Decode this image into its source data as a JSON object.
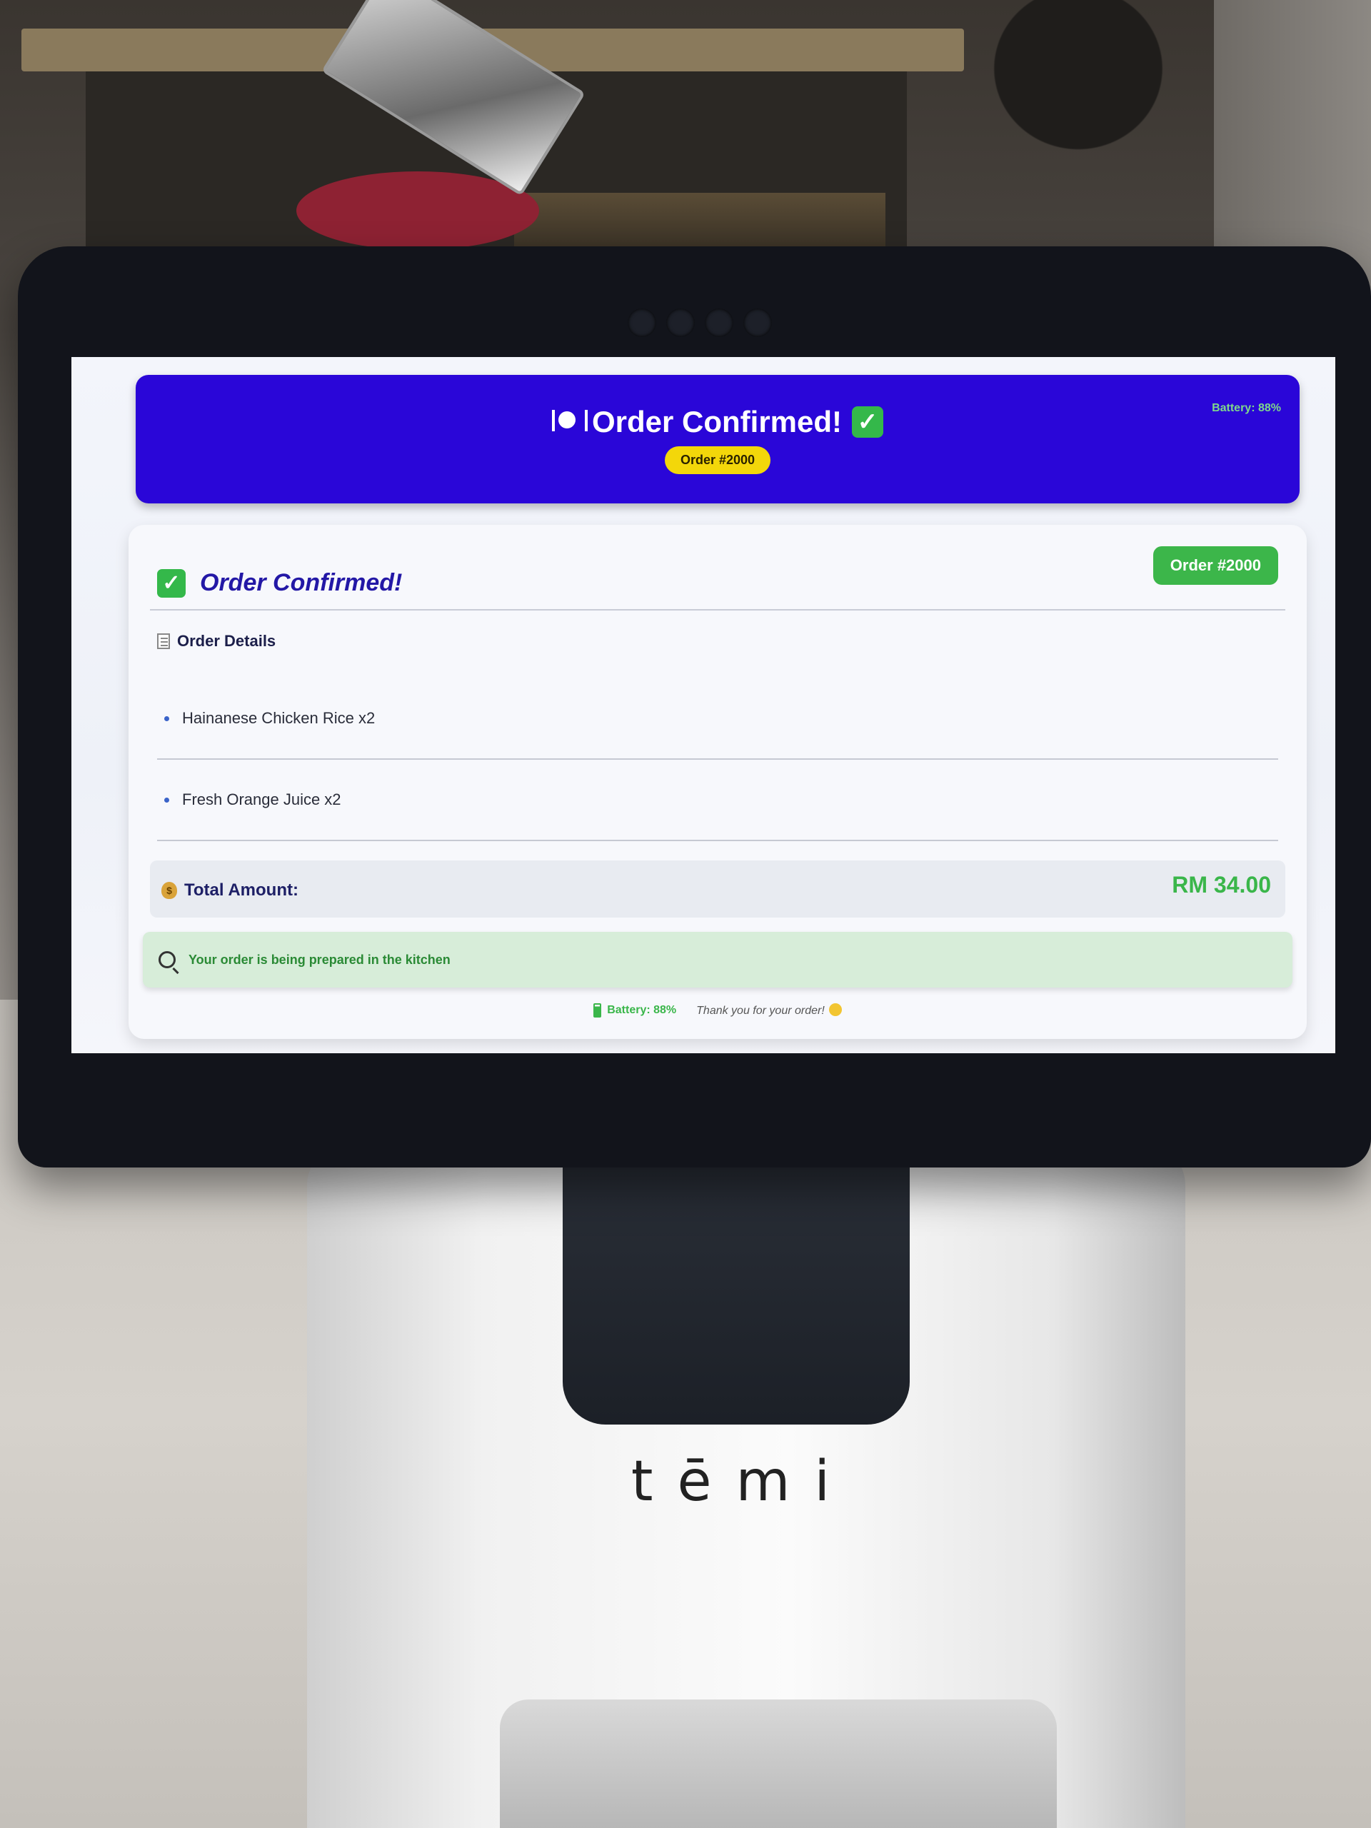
{
  "header": {
    "title": "Order Confirmed!",
    "order_pill": "Order #2000",
    "battery": "Battery: 88%"
  },
  "card": {
    "title": "Order Confirmed!",
    "order_badge": "Order #2000",
    "details_label": "Order Details",
    "items": [
      "Hainanese Chicken Rice x2",
      "Fresh Orange Juice x2"
    ],
    "total_label": "Total Amount:",
    "total_value": "RM 34.00",
    "status_text": "Your order is being prepared in the kitchen"
  },
  "footer": {
    "battery": "Battery: 88%",
    "thanks": "Thank you for your order!"
  },
  "device": {
    "brand": "tēmi"
  },
  "icons": {
    "plate": "plate-cutlery-icon",
    "check": "check-mark-icon",
    "receipt": "receipt-icon",
    "money": "money-bag-icon",
    "search": "magnifier-icon",
    "battery": "battery-icon",
    "smile": "smile-icon"
  },
  "colors": {
    "header_bg": "#2a06d8",
    "accent_green": "#3ab64a",
    "pill_yellow": "#f3d70a",
    "title_navy": "#2318a6"
  }
}
